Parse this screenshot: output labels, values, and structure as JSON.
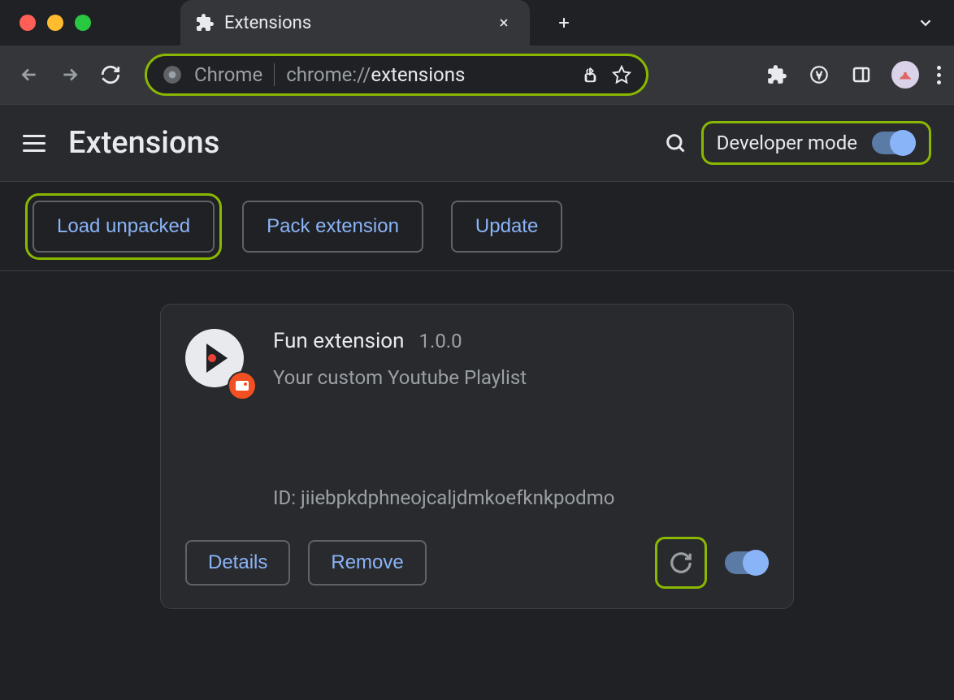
{
  "colors": {
    "highlight": "#8ab800",
    "accent": "#8ab4f8"
  },
  "tab": {
    "title": "Extensions"
  },
  "omnibox": {
    "label": "Chrome",
    "url_prefix": "chrome://",
    "url_path": "extensions"
  },
  "header": {
    "title": "Extensions",
    "dev_mode_label": "Developer mode",
    "dev_mode_on": true
  },
  "actions": {
    "load_unpacked": "Load unpacked",
    "pack_extension": "Pack extension",
    "update": "Update"
  },
  "extension": {
    "name": "Fun extension",
    "version": "1.0.0",
    "description": "Your custom Youtube Playlist",
    "id_label": "ID: jiiebpkdphneojcaljdmkoefknkpodmo",
    "details": "Details",
    "remove": "Remove",
    "enabled": true
  }
}
